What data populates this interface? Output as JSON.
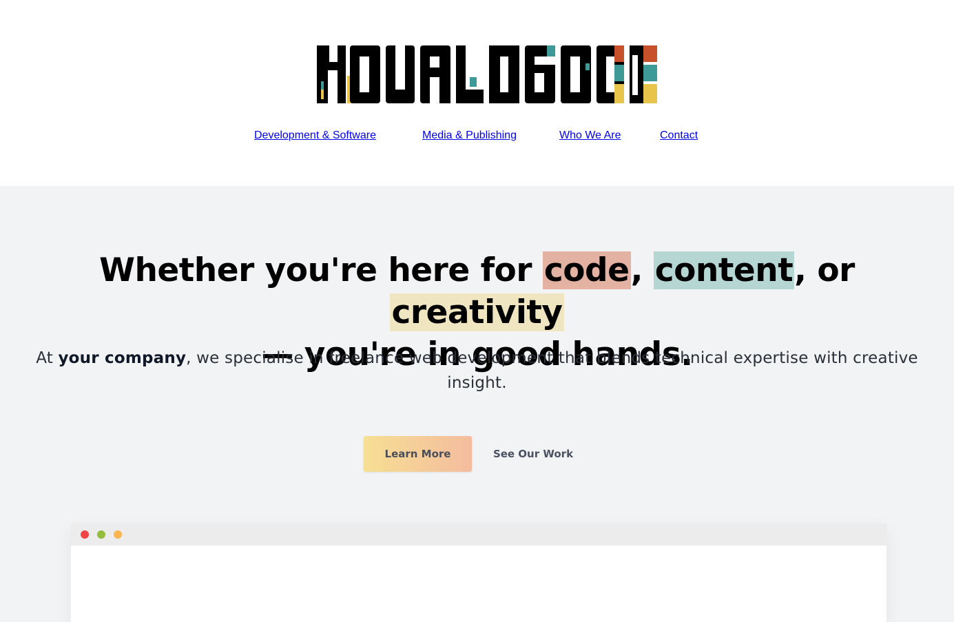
{
  "brand": {
    "logo_text": "YOURLOGO",
    "colors": {
      "red": "#c8502a",
      "teal": "#3d9a96",
      "yellow": "#e8c44a",
      "black": "#000000"
    }
  },
  "nav": {
    "items": [
      {
        "label": "Development & Software"
      },
      {
        "label": "Media & Publishing"
      },
      {
        "label": "Who We Are"
      },
      {
        "label": "Contact"
      }
    ]
  },
  "hero": {
    "headline": {
      "part1": "Whether you're here for ",
      "highlight1": "code",
      "part2": ", ",
      "highlight2": "content",
      "part3": ", or ",
      "highlight3": "creativity",
      "part4": "— you're in good hands."
    },
    "subline": {
      "prefix": "At ",
      "company": "your company",
      "rest": ", we specialise in freelance web development that blends technical expertise with creative insight."
    },
    "buttons": {
      "primary": "Learn More",
      "secondary": "See Our Work"
    },
    "highlight_colors": {
      "code": "#e3b2a3",
      "content": "#b6d6d4",
      "creativity": "#efe5c1"
    }
  },
  "browser_mock": {
    "dot_colors": [
      "#f04545",
      "#93bd3c",
      "#fbb64f"
    ]
  }
}
